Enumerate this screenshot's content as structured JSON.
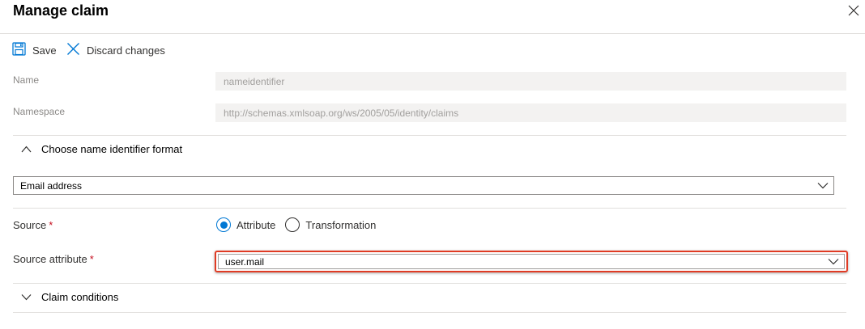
{
  "header": {
    "title": "Manage claim",
    "close_icon": "close-icon"
  },
  "toolbar": {
    "save_label": "Save",
    "save_icon": "floppy-disk-icon",
    "discard_label": "Discard changes",
    "discard_icon": "x-icon"
  },
  "fields": {
    "name_label": "Name",
    "name_value": "nameidentifier",
    "namespace_label": "Namespace",
    "namespace_value": "http://schemas.xmlsoap.org/ws/2005/05/identity/claims"
  },
  "name_id_format": {
    "section_label": "Choose name identifier format",
    "expanded": true,
    "selected": "Email address"
  },
  "source": {
    "label": "Source",
    "required_marker": "*",
    "options": [
      "Attribute",
      "Transformation"
    ],
    "selected": "Attribute"
  },
  "source_attribute": {
    "label": "Source attribute",
    "required_marker": "*",
    "selected": "user.mail",
    "highlight_color": "#e03b24"
  },
  "claim_conditions": {
    "label": "Claim conditions",
    "expanded": false
  },
  "colors": {
    "accent": "#0078d4",
    "required": "#c50f1f"
  }
}
